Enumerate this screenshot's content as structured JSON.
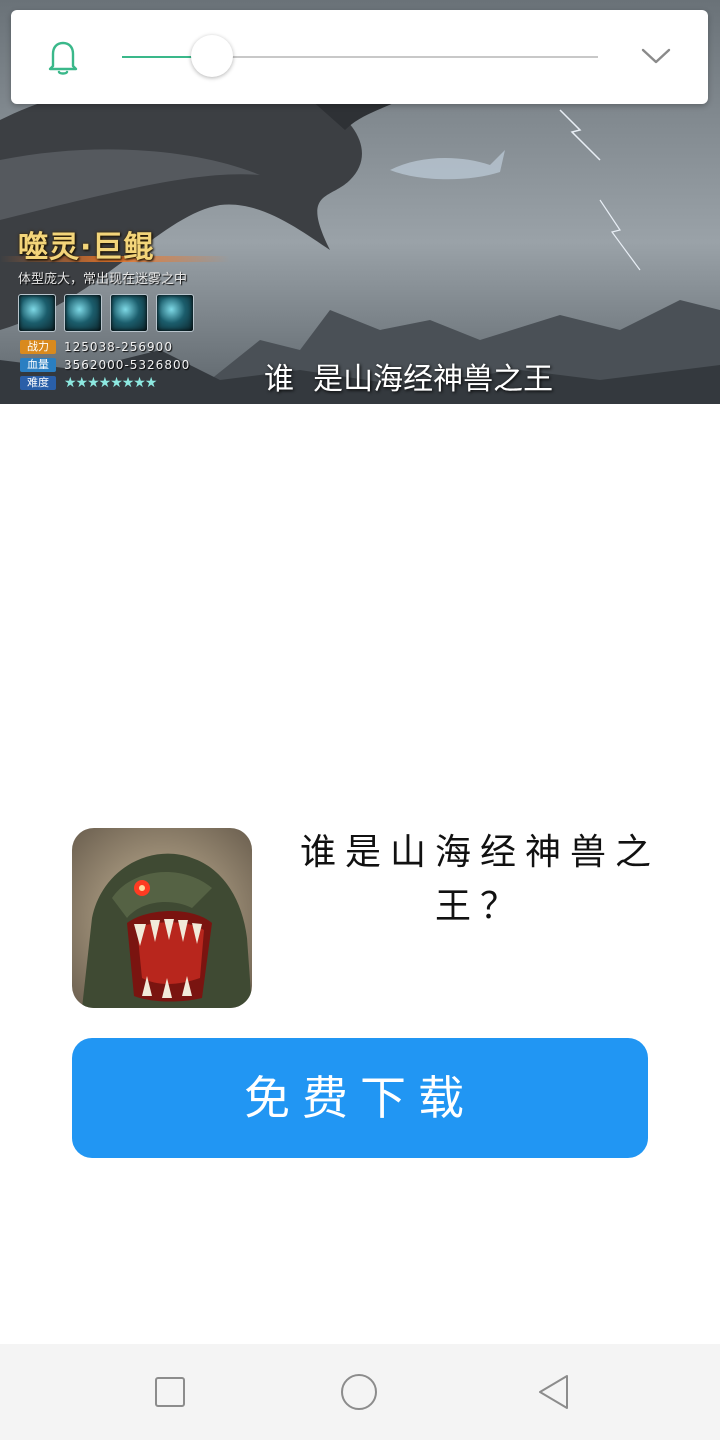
{
  "banner": {
    "character_name": "噬灵·巨鲲",
    "character_desc": "体型庞大，常出现在迷雾之中",
    "stats": [
      {
        "label": "战力",
        "value": "125038-256900",
        "color": "#d98a1e"
      },
      {
        "label": "血量",
        "value": "3562000-5326800",
        "color": "#2a7fc2"
      },
      {
        "label": "难度",
        "value": "★★★★★★★★",
        "color": "#2a5fa8"
      }
    ],
    "subtitle": "谁  是山海经神兽之王"
  },
  "controls": {
    "bell_icon": "bell-icon",
    "progress": 0.19,
    "collapse_icon": "chevron-down-icon",
    "accent_color": "#3ab88a"
  },
  "ad": {
    "title": "谁是山海经神兽之王？",
    "download_label": "免费下载",
    "button_color": "#2196f3"
  },
  "navbar": {
    "recent_icon": "square-icon",
    "home_icon": "circle-icon",
    "back_icon": "triangle-back-icon"
  }
}
